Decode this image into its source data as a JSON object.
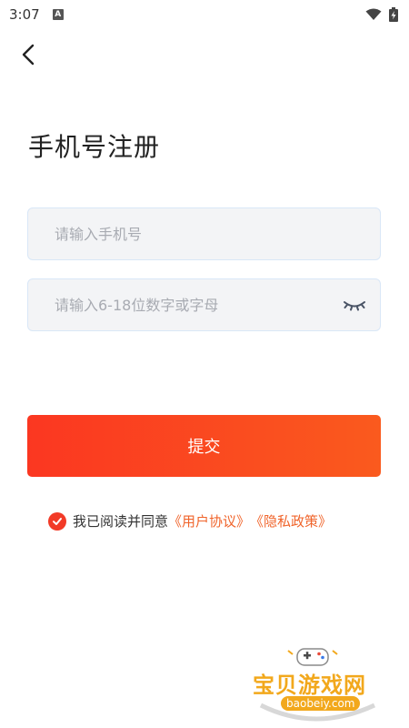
{
  "status_bar": {
    "time": "3:07",
    "notification_icon": "a-badge-icon",
    "wifi_icon": "wifi-icon",
    "battery_icon": "battery-charging-icon"
  },
  "header": {
    "back_icon": "chevron-left-icon"
  },
  "title": "手机号注册",
  "form": {
    "phone_placeholder": "请输入手机号",
    "password_placeholder": "请输入6-18位数字或字母",
    "eye_icon": "eye-closed-icon"
  },
  "submit_label": "提交",
  "agreement": {
    "checked": true,
    "prefix": "我已阅读并同意",
    "user_agreement": "《用户协议》",
    "privacy_policy": "《隐私政策》"
  },
  "watermark": {
    "text": "宝贝游戏网",
    "domain": "baobeiy.com"
  },
  "colors": {
    "accent": "#fa4a20",
    "link": "#f0642b",
    "watermark": "#f2a81c"
  }
}
